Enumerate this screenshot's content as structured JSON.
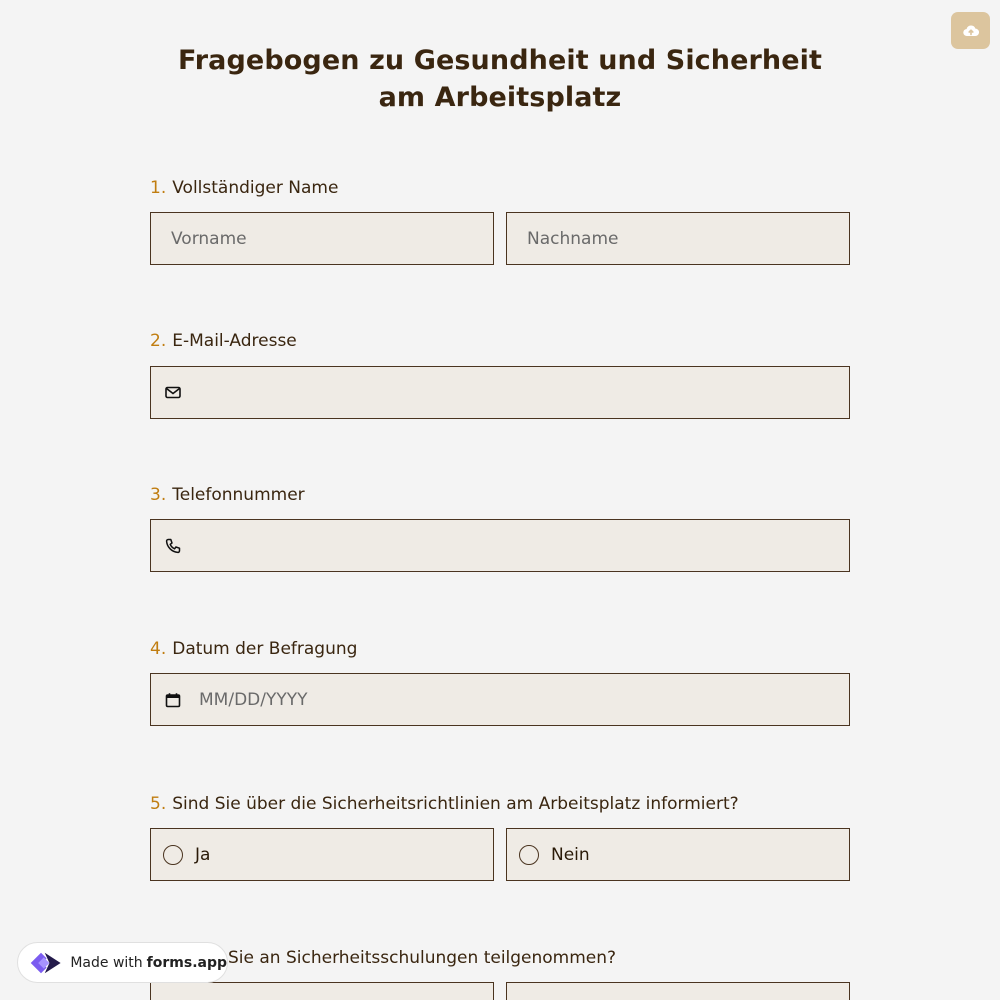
{
  "save_button": {
    "icon": "cloud-upload-icon",
    "color": "#dcc59e"
  },
  "form": {
    "title": "Fragebogen zu Gesundheit und Sicherheit am Arbeitsplatz",
    "questions": [
      {
        "number": "1.",
        "label": "Vollständiger Name",
        "first_placeholder": "Vorname",
        "last_placeholder": "Nachname"
      },
      {
        "number": "2.",
        "label": "E-Mail-Adresse",
        "icon": "mail-icon"
      },
      {
        "number": "3.",
        "label": "Telefonnummer",
        "icon": "phone-icon"
      },
      {
        "number": "4.",
        "label": "Datum der Befragung",
        "placeholder": "MM/DD/YYYY",
        "icon": "calendar-icon"
      },
      {
        "number": "5.",
        "label": "Sind Sie über die Sicherheitsrichtlinien am Arbeitsplatz informiert?",
        "options": [
          "Ja",
          "Nein"
        ]
      },
      {
        "label_tail": "Sie an Sicherheitsschulungen teilgenommen?"
      }
    ]
  },
  "badge": {
    "prefix": "Made with",
    "brand": "forms.app"
  },
  "colors": {
    "accent_number": "#c07d10",
    "field_bg": "#efebe5",
    "field_border": "#4a3420",
    "page_bg": "#f4f4f4"
  }
}
